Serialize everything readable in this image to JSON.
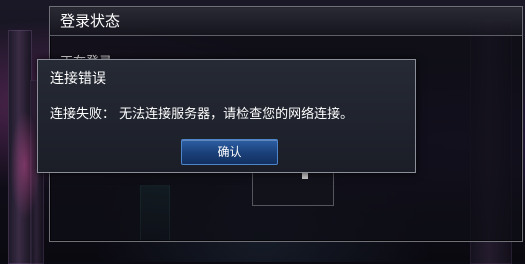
{
  "login_panel": {
    "title": "登录状态",
    "status": "正在登录……"
  },
  "error_dialog": {
    "title": "连接错误",
    "message": "连接失败： 无法连接服务器，请检查您的网络连接。",
    "ok_label": "确认"
  }
}
